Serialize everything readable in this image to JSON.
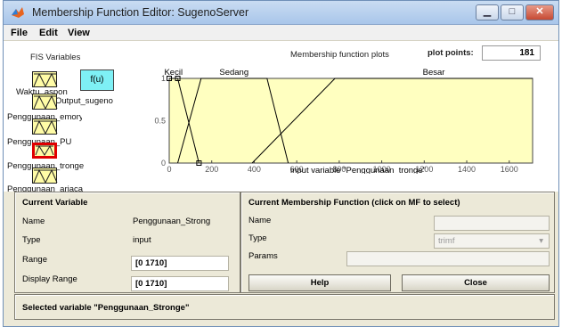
{
  "window": {
    "title": "Membership Function Editor: SugenoServer",
    "minimize_symbol": "▁",
    "maximize_symbol": "□",
    "close_symbol": "✕"
  },
  "menu": [
    "File",
    "Edit",
    "View"
  ],
  "fis": {
    "heading": "FIS Variables",
    "output_label": "f(u)",
    "variables": [
      "Waktu_aspon",
      "Output_sugeno",
      "Penggunaan_emory",
      "Penggunaan_PU",
      "Penggunaan_tronge",
      "Penggunaan_ariaca"
    ],
    "selected_color": "#e00000"
  },
  "plot": {
    "heading": "Membership function plots",
    "plot_points_label": "plot points:",
    "plot_points_value": "181",
    "xlabel": "input variable \"Penggunaan_tronge\"",
    "background": "#ffffc0"
  },
  "chart_data": {
    "type": "line",
    "xlim": [
      0,
      1710
    ],
    "ylim": [
      0,
      1
    ],
    "x_ticks": [
      0,
      200,
      400,
      600,
      800,
      1000,
      1200,
      1400,
      1600
    ],
    "y_ticks": [
      "0",
      "0.5",
      "1"
    ],
    "series": [
      {
        "name": "Kecil",
        "x": [
          0,
          40,
          140
        ],
        "y": [
          1,
          1,
          0
        ]
      },
      {
        "name": "Sedang",
        "x": [
          40,
          150,
          460,
          560
        ],
        "y": [
          0,
          1,
          1,
          0
        ]
      },
      {
        "name": "Besar",
        "x": [
          390,
          780,
          1710
        ],
        "y": [
          0,
          1,
          1
        ]
      }
    ],
    "selected_series": "Kecil"
  },
  "current_variable": {
    "heading": "Current Variable",
    "name_label": "Name",
    "name_value": "Penggunaan_Strong",
    "type_label": "Type",
    "type_value": "input",
    "range_label": "Range",
    "range_value": "[0 1710]",
    "display_range_label": "Display Range",
    "display_range_value": "[0 1710]"
  },
  "current_mf": {
    "heading": "Current Membership Function (click on MF to select)",
    "name_label": "Name",
    "type_label": "Type",
    "type_value": "trimf",
    "params_label": "Params"
  },
  "buttons": {
    "help": "Help",
    "close": "Close"
  },
  "status": "Selected variable \"Penggunaan_Stronge\""
}
